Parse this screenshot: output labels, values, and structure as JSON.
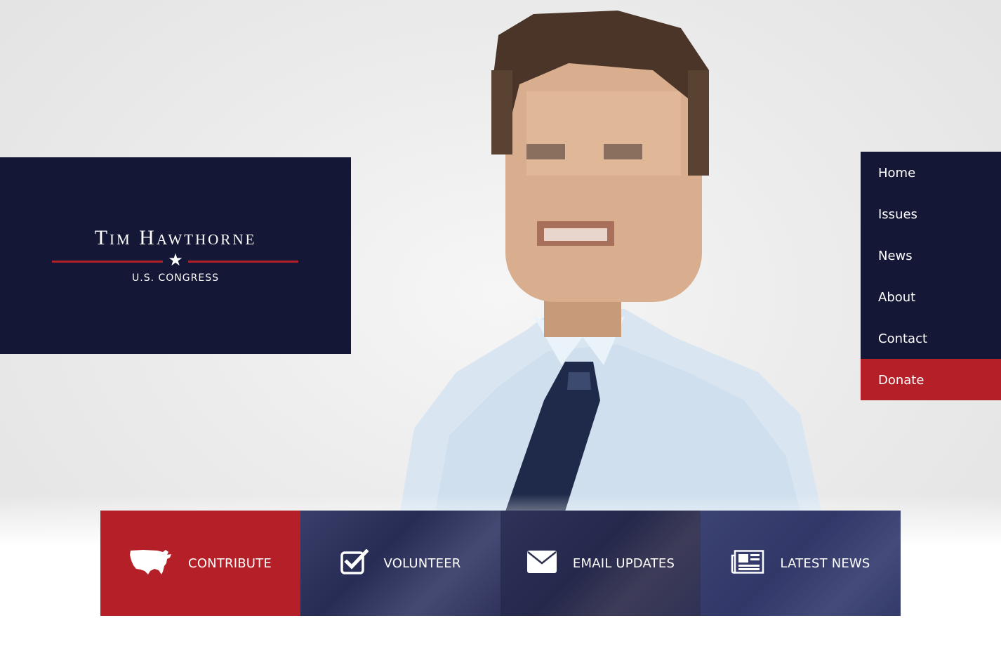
{
  "logo": {
    "name": "Tim Hawthorne",
    "subtitle": "U.S. CONGRESS",
    "star": "★"
  },
  "nav": {
    "items": [
      {
        "label": "Home"
      },
      {
        "label": "Issues"
      },
      {
        "label": "News"
      },
      {
        "label": "About"
      },
      {
        "label": "Contact"
      },
      {
        "label": "Donate"
      }
    ]
  },
  "actions": [
    {
      "label": "CONTRIBUTE",
      "icon": "usa-map-icon"
    },
    {
      "label": "VOLUNTEER",
      "icon": "checkbox-icon"
    },
    {
      "label": "EMAIL UPDATES",
      "icon": "envelope-icon"
    },
    {
      "label": "LATEST NEWS",
      "icon": "newspaper-icon"
    }
  ],
  "colors": {
    "navy": "#141736",
    "red": "#b51f27",
    "white": "#ffffff"
  }
}
